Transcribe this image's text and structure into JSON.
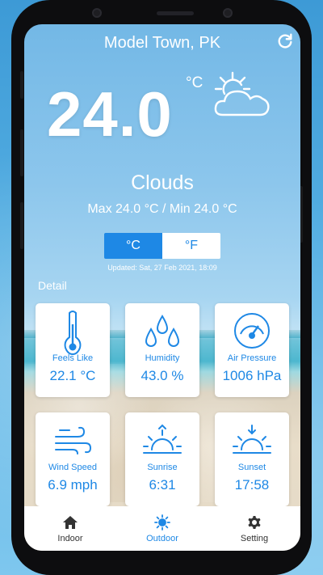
{
  "header": {
    "location": "Model Town, PK",
    "refresh_icon": "refresh-icon"
  },
  "current": {
    "temperature": "24.0",
    "unit_symbol": "°C",
    "weather_icon": "partly-cloudy-icon",
    "condition": "Clouds",
    "minmax": "Max 24.0 °C / Min 24.0 °C"
  },
  "unit_toggle": {
    "celsius_label": "°C",
    "fahrenheit_label": "°F",
    "selected": "celsius"
  },
  "updated": "Updated: Sat, 27 Feb 2021, 18:09",
  "detail": {
    "title": "Detail",
    "cards": [
      {
        "icon": "thermometer-icon",
        "label": "Feels Like",
        "value": "22.1 °C"
      },
      {
        "icon": "humidity-drops-icon",
        "label": "Humidity",
        "value": "43.0 %"
      },
      {
        "icon": "gauge-icon",
        "label": "Air Pressure",
        "value": "1006 hPa"
      },
      {
        "icon": "wind-icon",
        "label": "Wind Speed",
        "value": "6.9 mph"
      },
      {
        "icon": "sunrise-icon",
        "label": "Sunrise",
        "value": "6:31"
      },
      {
        "icon": "sunset-icon",
        "label": "Sunset",
        "value": "17:58"
      }
    ]
  },
  "bottom_nav": {
    "items": [
      {
        "icon": "home-icon",
        "label": "Indoor"
      },
      {
        "icon": "sun-icon",
        "label": "Outdoor"
      },
      {
        "icon": "gear-icon",
        "label": "Setting"
      }
    ],
    "active": "Outdoor"
  },
  "colors": {
    "accent": "#1e88e5",
    "sky": "#8cc6ec",
    "card_bg": "#ffffff"
  }
}
